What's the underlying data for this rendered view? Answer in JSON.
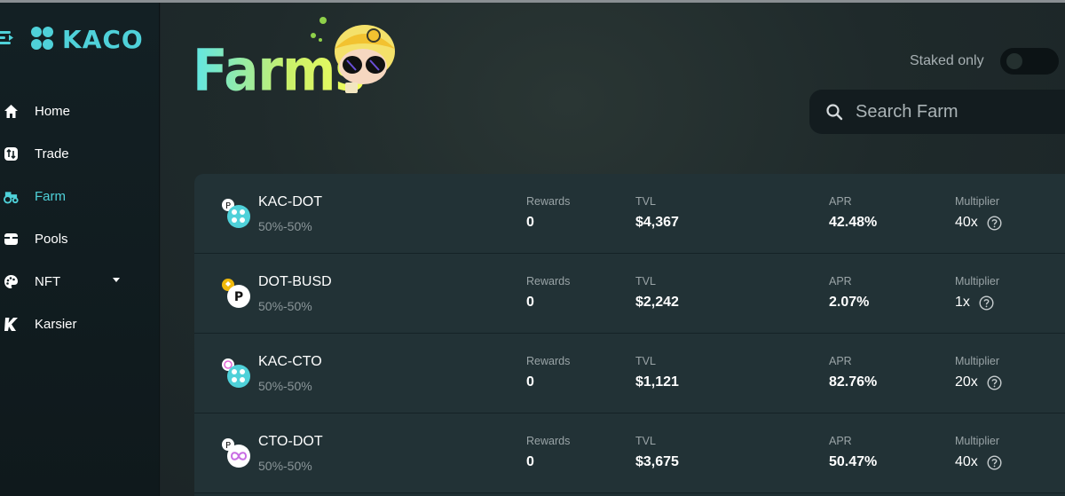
{
  "brand": {
    "name": "KACO",
    "accent": "#4fd1d9"
  },
  "sidebar": {
    "items": [
      {
        "label": "Home",
        "icon": "home-icon",
        "active": false
      },
      {
        "label": "Trade",
        "icon": "trade-icon",
        "active": false
      },
      {
        "label": "Farm",
        "icon": "tractor-icon",
        "active": true
      },
      {
        "label": "Pools",
        "icon": "pools-icon",
        "active": false
      },
      {
        "label": "NFT",
        "icon": "palette-icon",
        "active": false,
        "has_dropdown": true
      },
      {
        "label": "Karsier",
        "icon": "karsier-k-icon",
        "active": false
      }
    ]
  },
  "header": {
    "title": "Farms",
    "staked_only_label": "Staked only",
    "staked_only_on": false,
    "search_placeholder": "Search Farm"
  },
  "farms": {
    "columns": {
      "rewards": "Rewards",
      "tvl": "TVL",
      "apr": "APR",
      "multiplier": "Multiplier"
    },
    "rows": [
      {
        "pair": "KAC-DOT",
        "split": "50%-50%",
        "rewards": "0",
        "tvl": "$4,367",
        "apr": "42.48%",
        "multiplier": "40x"
      },
      {
        "pair": "DOT-BUSD",
        "split": "50%-50%",
        "rewards": "0",
        "tvl": "$2,242",
        "apr": "2.07%",
        "multiplier": "1x"
      },
      {
        "pair": "KAC-CTO",
        "split": "50%-50%",
        "rewards": "0",
        "tvl": "$1,121",
        "apr": "82.76%",
        "multiplier": "20x"
      },
      {
        "pair": "CTO-DOT",
        "split": "50%-50%",
        "rewards": "0",
        "tvl": "$3,675",
        "apr": "50.47%",
        "multiplier": "40x"
      }
    ]
  }
}
